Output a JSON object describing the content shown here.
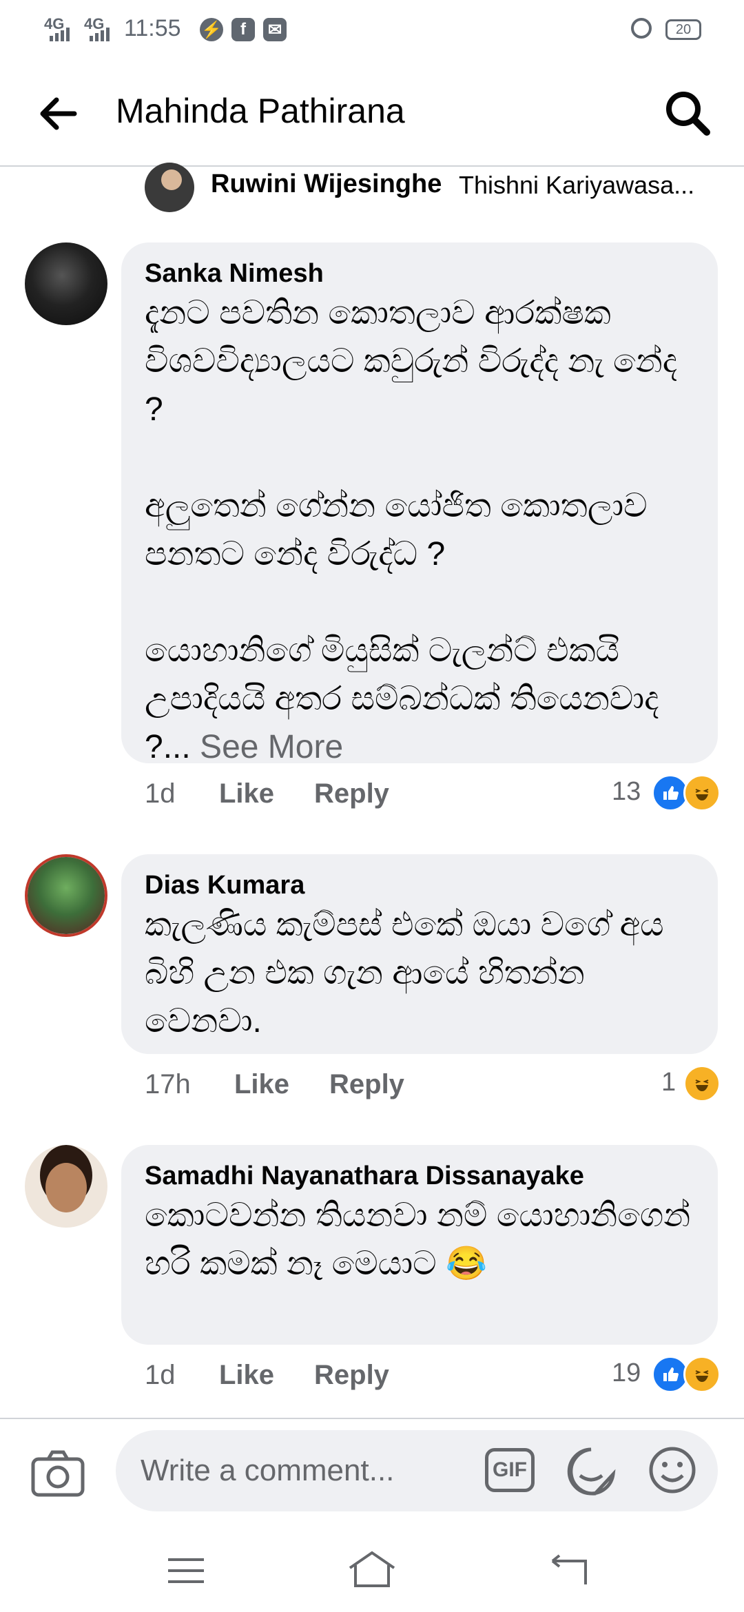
{
  "status_bar": {
    "network1": "4G",
    "network2": "4G",
    "time": "11:55",
    "battery": "20"
  },
  "header": {
    "title": "Mahinda Pathirana"
  },
  "reactors": {
    "name1": "Ruwini Wijesinghe",
    "name2": "Thishni Kariyawasa..."
  },
  "comments": [
    {
      "author": "Sanka Nimesh",
      "text": "දැනට පවතින කොතලාව ආරක්ෂක විශවවිද්‍යාලයට කවුරුන් විරුද්ද නැ නේද ?\n\nඅලුතෙන් ගේන්න යෝජිත කොතලාව පනතට නේද  විරුද්ධ ?\n\nයොහානිගේ මියුසික් ටැලන්ට් එකයි උපාදියයි අතර සම්බන්ධක් තියෙනවාද ?...",
      "see_more": "See More",
      "time": "1d",
      "like": "Like",
      "reply": "Reply",
      "reaction_count": "13"
    },
    {
      "author": "Dias Kumara",
      "text": "කැලණිය කැම්පස් එකේ ඔයා වගේ අය බිහි උන එක ගැන ආයේ හිතන්න වෙනවා.",
      "time": "17h",
      "like": "Like",
      "reply": "Reply",
      "reaction_count": "1"
    },
    {
      "author": "Samadhi Nayanathara Dissanayake",
      "text": "කොටවන්න තියනවා නම් යොහානිගෙන් හරි කමක් නෑ මෙයාට 😂",
      "time": "1d",
      "like": "Like",
      "reply": "Reply",
      "reaction_count": "19"
    }
  ],
  "composer": {
    "placeholder": "Write a comment...",
    "gif_label": "GIF"
  },
  "colors": {
    "like_blue": "#1877f2",
    "haha_yellow": "#f7b125",
    "bubble_bg": "#eff0f3",
    "meta_gray": "#65676b"
  }
}
